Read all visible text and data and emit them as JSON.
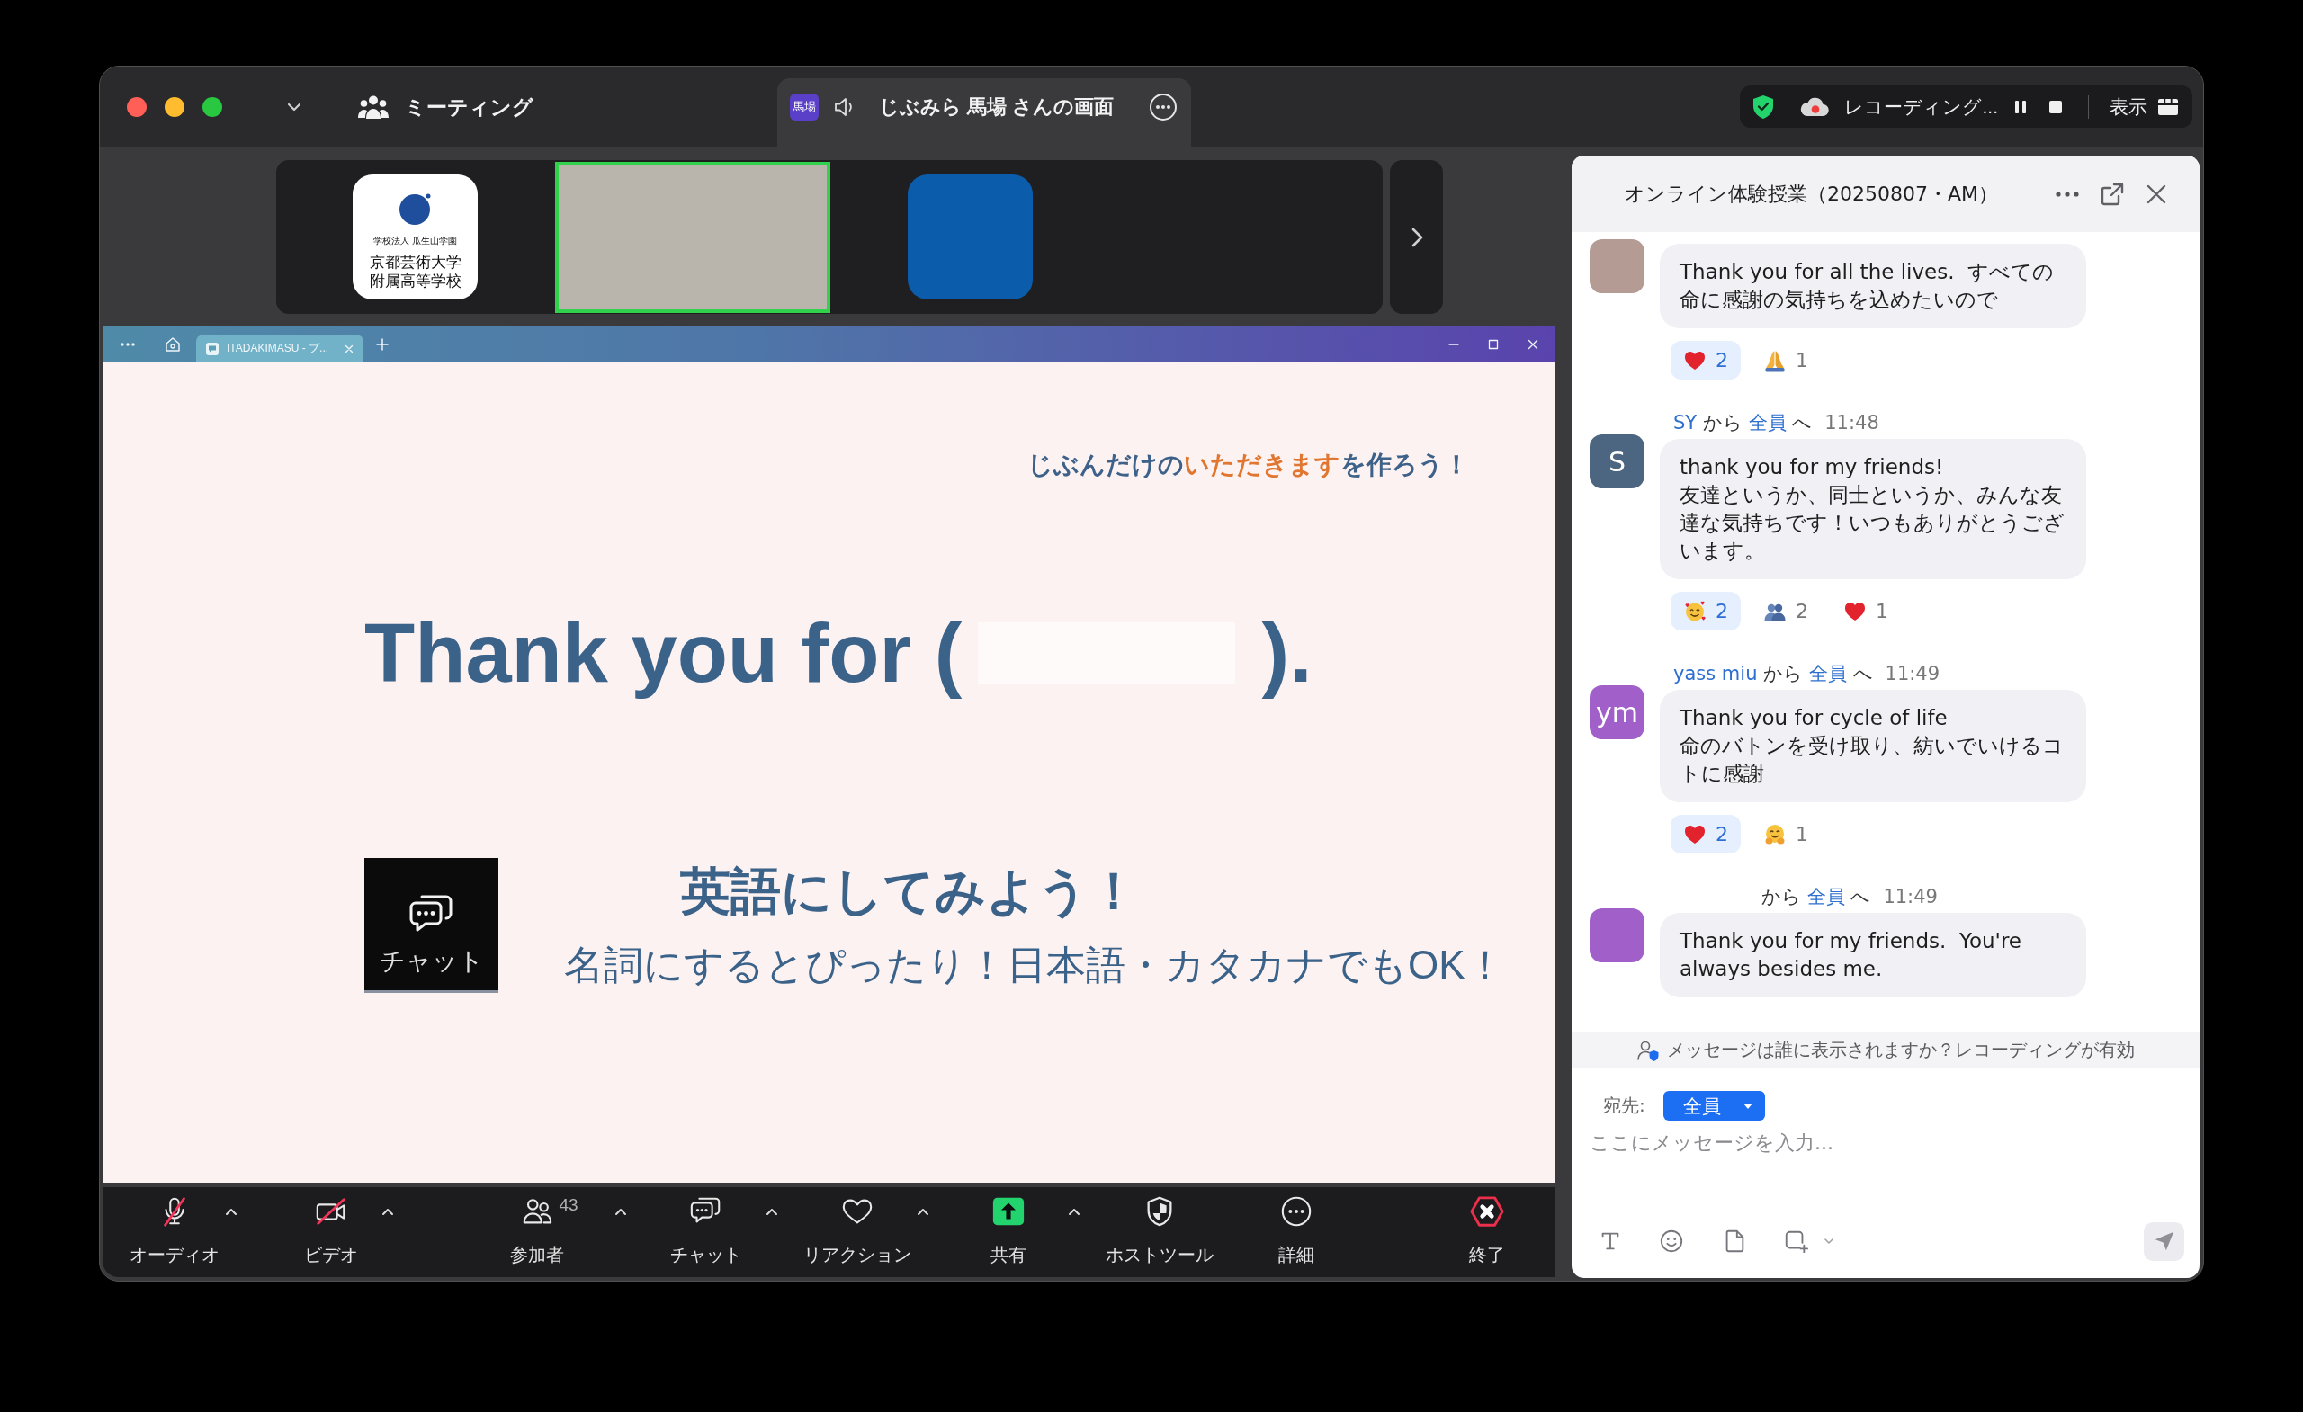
{
  "title_bar": {
    "meeting_label": "ミーティング",
    "share_tab": {
      "badge": "馬場",
      "title": "じぶみら 馬場 さんの画面"
    },
    "status": {
      "encrypted": true,
      "recording_label": "レコーディング...",
      "view_label": "表示"
    }
  },
  "thumbnails": [
    {
      "kind": "logo",
      "lines": [
        "学校法人 瓜生山学園",
        "京都芸術大学",
        "附属高等学校"
      ],
      "speaking": false
    },
    {
      "kind": "video",
      "speaking": true
    },
    {
      "kind": "tile",
      "speaking": false
    }
  ],
  "shared_screen": {
    "tab_title": "ITADAKIMASU - プ...",
    "slide": {
      "tagline": [
        {
          "text": "じぶんだけの",
          "emphasis": false
        },
        {
          "text": "いただきます",
          "emphasis": true
        },
        {
          "text": "を作ろう！",
          "emphasis": false
        }
      ],
      "prompt_start": "Thank you for (",
      "prompt_end": ").",
      "tile_label": "チャット",
      "heading": "英語にしてみよう！",
      "hint": "名詞にするとぴったり！日本語・カタカナでもOK！"
    }
  },
  "toolbar": [
    {
      "kind": "audio",
      "label": "オーディオ",
      "muted": true,
      "has_menu": true
    },
    {
      "kind": "video",
      "label": "ビデオ",
      "muted": true,
      "has_menu": true
    },
    {
      "kind": "participants",
      "label": "参加者",
      "count": "43",
      "has_menu": true
    },
    {
      "kind": "chat",
      "label": "チャット",
      "has_menu": true
    },
    {
      "kind": "reactions",
      "label": "リアクション",
      "has_menu": true
    },
    {
      "kind": "share",
      "label": "共有",
      "has_menu": true
    },
    {
      "kind": "host_tools",
      "label": "ホストツール",
      "has_menu": false
    },
    {
      "kind": "more",
      "label": "詳細",
      "has_menu": false
    },
    {
      "kind": "end",
      "label": "終了",
      "has_menu": false
    }
  ],
  "chat": {
    "title": "オンライン体験授業（20250807・AM）",
    "messages": [
      {
        "avatar": {
          "kind": "photo"
        },
        "text": "Thank you for all the lives.  すべての命に感謝の気持ちを込めたいので",
        "reactions": [
          {
            "kind": "heart",
            "count": "2",
            "selected": true
          },
          {
            "kind": "folded_hands",
            "count": "1",
            "selected": false
          }
        ]
      },
      {
        "header": {
          "sender": "SY",
          "from": "から",
          "recipient": "全員",
          "to": "へ",
          "time": "11:48"
        },
        "avatar": {
          "kind": "initials",
          "initials": "S",
          "color": "#4c6580"
        },
        "text": "thank you for my friends!\n友達というか、同士というか、みんな友達な気持ちです！いつもありがとうございます。",
        "reactions": [
          {
            "kind": "smiling_hearts",
            "count": "2",
            "selected": true
          },
          {
            "kind": "busts",
            "count": "2",
            "selected": false
          },
          {
            "kind": "heart",
            "count": "1",
            "selected": false
          }
        ]
      },
      {
        "header": {
          "sender": "yass miu",
          "from": "から",
          "recipient": "全員",
          "to": "へ",
          "time": "11:49"
        },
        "avatar": {
          "kind": "initials",
          "initials": "ym",
          "color": "#a160c9"
        },
        "text": "Thank you for cycle of life\n命のバトンを受け取り、紡いでいけるコトに感謝",
        "reactions": [
          {
            "kind": "heart",
            "count": "2",
            "selected": true
          },
          {
            "kind": "hugging",
            "count": "1",
            "selected": false
          }
        ]
      },
      {
        "header": {
          "from": "から",
          "recipient": "全員",
          "to": "へ",
          "time": "11:49"
        },
        "avatar": {
          "kind": "plain",
          "color": "#a160c9"
        },
        "text": "Thank you for my friends.  You're always besides me."
      }
    ],
    "notice": "メッセージは誰に表示されますか？レコーディングが有効",
    "recipient_label": "宛先:",
    "recipient": "全員",
    "placeholder": "ここにメッセージを入力..."
  }
}
